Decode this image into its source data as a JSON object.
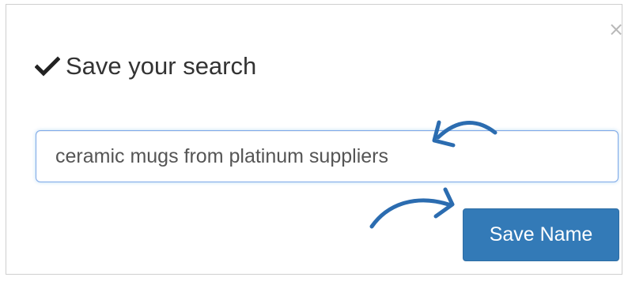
{
  "dialog": {
    "title": "Save your search",
    "close_label": "×",
    "check_icon": "checkmark-icon"
  },
  "search": {
    "value": "ceramic mugs from platinum suppliers",
    "placeholder": ""
  },
  "actions": {
    "save_label": "Save Name"
  },
  "colors": {
    "accent": "#337ab7",
    "annotation_arrow": "#2b6cb0",
    "input_border": "#7ea9e8"
  }
}
